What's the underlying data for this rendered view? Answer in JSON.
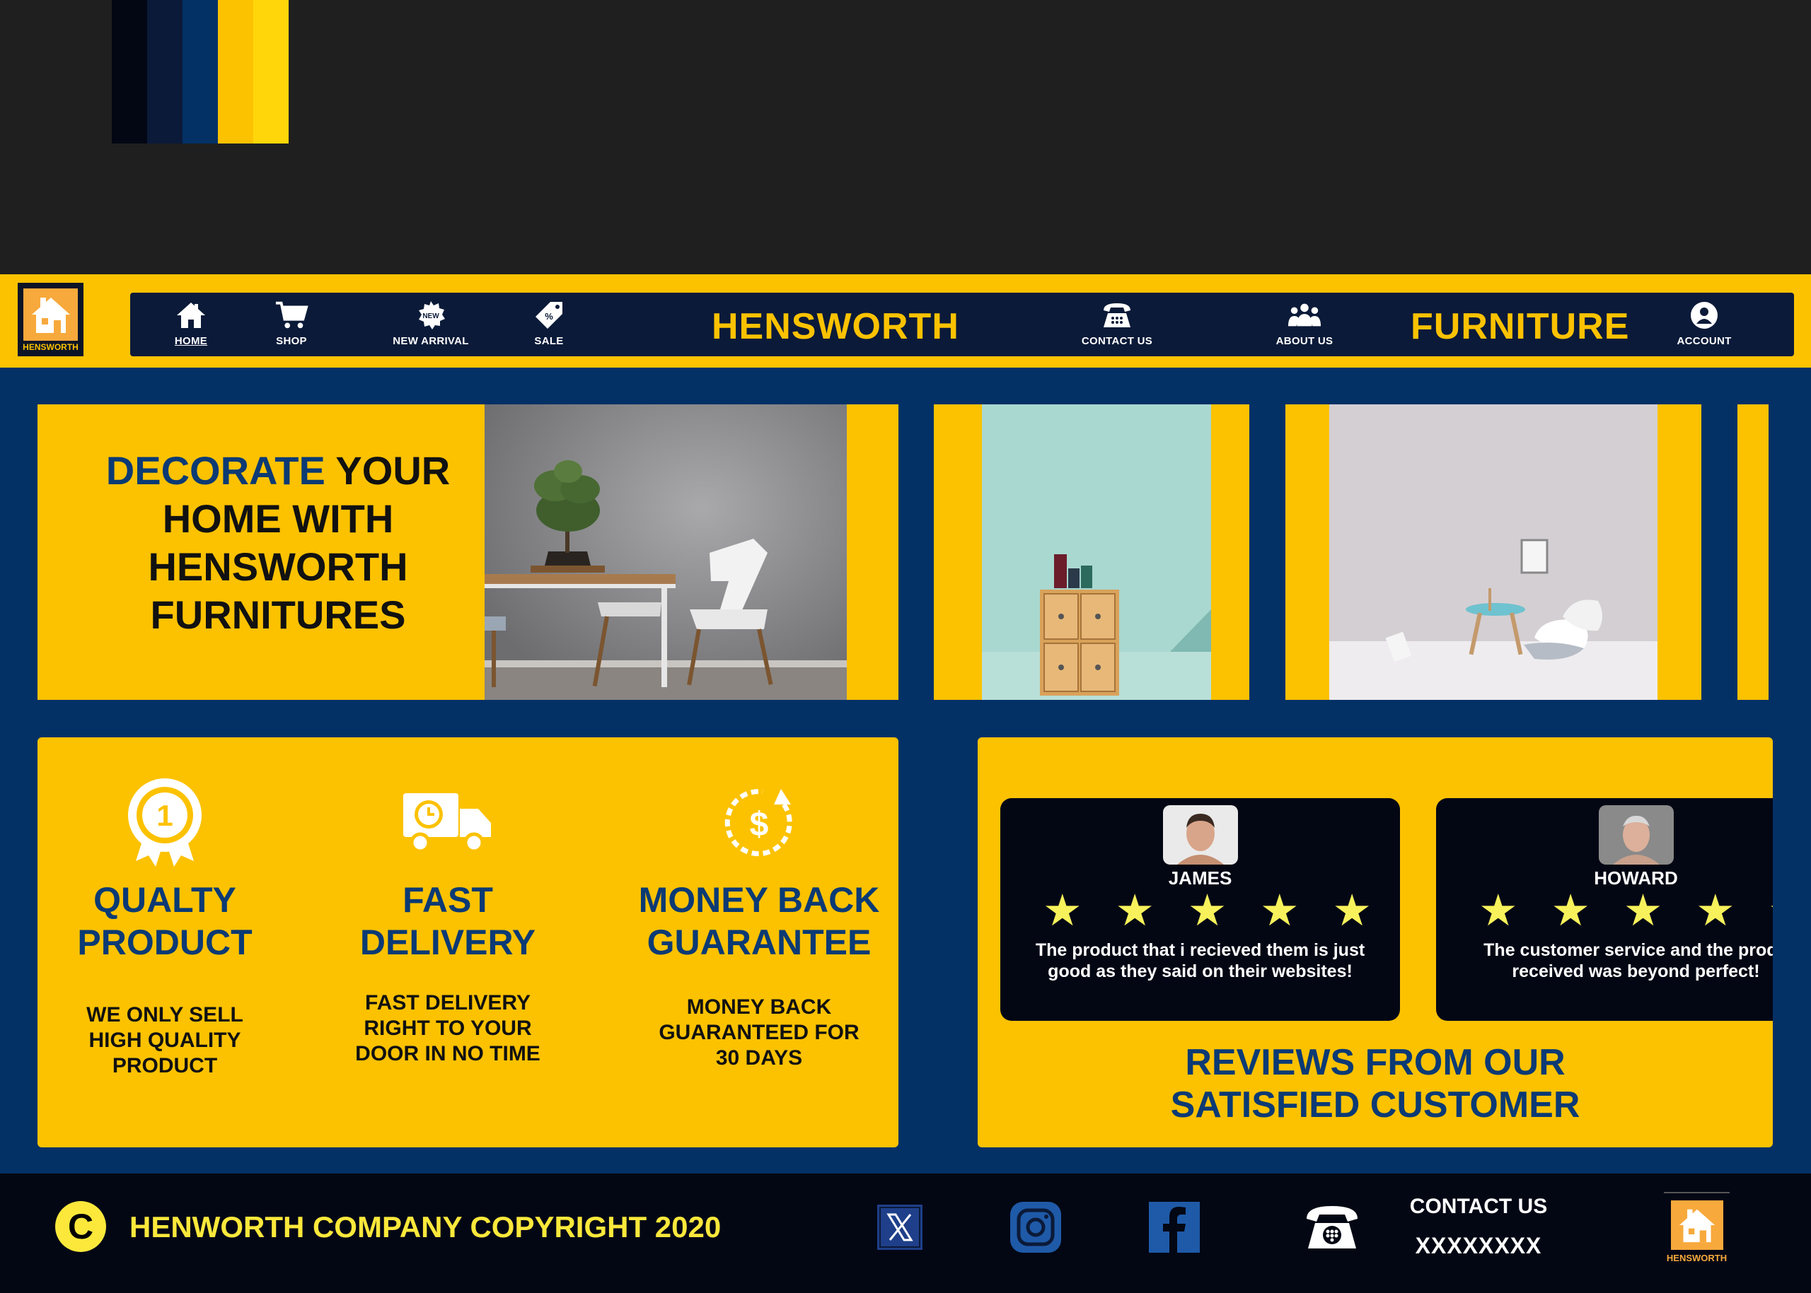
{
  "palette": [
    "#030714",
    "#0b1a38",
    "#033166",
    "#fcc200",
    "#ffd60a"
  ],
  "logo": {
    "label": "HENSWORTH"
  },
  "nav": {
    "items": [
      {
        "label": "HOME",
        "icon": "home-icon"
      },
      {
        "label": "SHOP",
        "icon": "cart-icon"
      },
      {
        "label": "NEW ARRIVAL",
        "icon": "new-badge-icon",
        "badge": "NEW"
      },
      {
        "label": "SALE",
        "icon": "price-tag-icon"
      },
      {
        "label": "CONTACT US",
        "icon": "phone-icon"
      },
      {
        "label": "ABOUT US",
        "icon": "group-icon"
      },
      {
        "label": "ACCOUNT",
        "icon": "account-icon"
      }
    ],
    "brand_left": "HENSWORTH",
    "brand_right": "FURNITURE"
  },
  "hero": {
    "title_accent": "DECORATE",
    "title_line1_rest": " YOUR",
    "title_line2": "HOME WITH",
    "title_line3": "HENSWORTH",
    "title_line4": "FURNITURES"
  },
  "features": [
    {
      "title_line1": "QUALTY",
      "title_line2": "PRODUCT",
      "desc": "WE ONLY SELL HIGH QUALITY PRODUCT",
      "icon": "award-medal-icon"
    },
    {
      "title_line1": "FAST",
      "title_line2": "DELIVERY",
      "desc": "FAST DELIVERY RIGHT TO YOUR DOOR IN NO TIME",
      "icon": "delivery-truck-icon"
    },
    {
      "title_line1": "MONEY BACK",
      "title_line2": "GUARANTEE",
      "desc": "MONEY BACK GUARANTEED FOR 30 DAYS",
      "icon": "money-back-icon"
    }
  ],
  "reviews": {
    "items": [
      {
        "name": "JAMES",
        "rating": 5,
        "text_line1": "The product that i  recieved them is just",
        "text_line2": "good as they said on their websites!"
      },
      {
        "name": "HOWARD",
        "rating": 5,
        "text_line1": "The customer service and the produ",
        "text_line2": "received was beyond perfect!"
      }
    ],
    "heading_line1": "REVIEWS FROM OUR",
    "heading_line2": "SATISFIED CUSTOMER"
  },
  "footer": {
    "copyright_symbol": "C",
    "copyright": "HENWORTH COMPANY COPYRIGHT 2020",
    "socials": [
      "x-icon",
      "instagram-icon",
      "facebook-icon"
    ],
    "contact_title": "CONTACT US",
    "contact_number": "XXXXXXXX",
    "logo_label": "HENSWORTH"
  }
}
